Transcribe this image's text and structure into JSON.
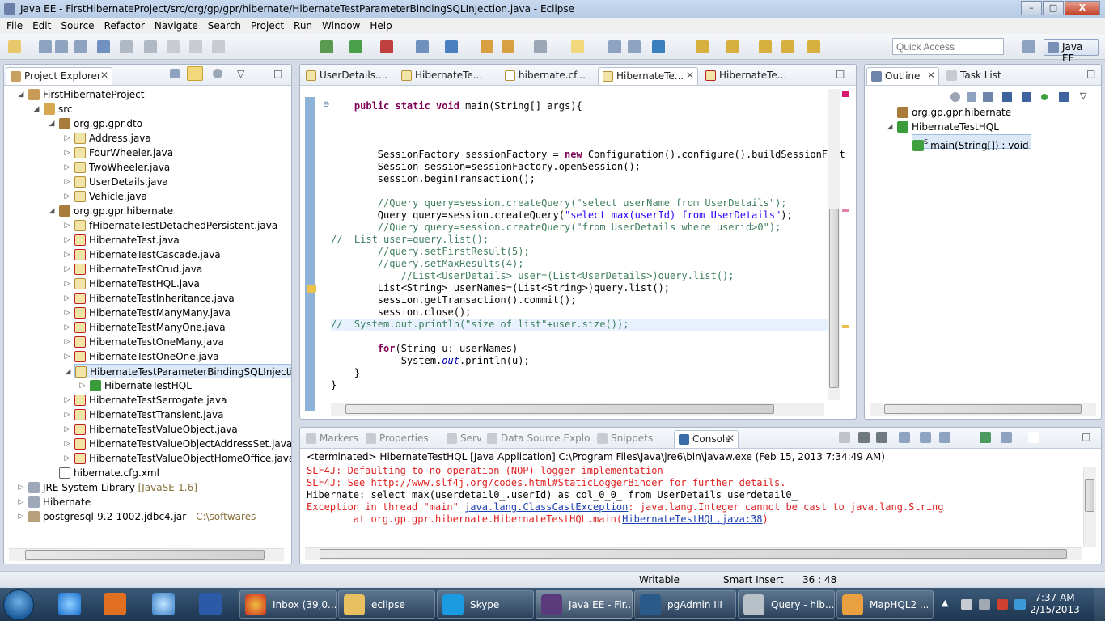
{
  "window": {
    "title": "Java EE - FirstHibernateProject/src/org/gp/gpr/hibernate/HibernateTestParameterBindingSQLInjection.java - Eclipse",
    "controls": {
      "minimize": "–",
      "maximize": "□",
      "close": "X"
    }
  },
  "menu": [
    "File",
    "Edit",
    "Source",
    "Refactor",
    "Navigate",
    "Search",
    "Project",
    "Run",
    "Window",
    "Help"
  ],
  "toolbar": {
    "quick_access_placeholder": "Quick Access",
    "perspective": "Java EE"
  },
  "project_explorer": {
    "title": "Project Explorer",
    "tree": [
      {
        "label": "FirstHibernateProject",
        "icon": "project-icon",
        "depth": 0,
        "twisty": "open"
      },
      {
        "label": "src",
        "icon": "source-folder-icon",
        "depth": 1,
        "twisty": "open"
      },
      {
        "label": "org.gp.gpr.dto",
        "icon": "package-icon",
        "depth": 2,
        "twisty": "open"
      },
      {
        "label": "Address.java",
        "icon": "java-file-icon",
        "depth": 3,
        "twisty": "closed"
      },
      {
        "label": "FourWheeler.java",
        "icon": "java-file-icon",
        "depth": 3,
        "twisty": "closed"
      },
      {
        "label": "TwoWheeler.java",
        "icon": "java-file-icon",
        "depth": 3,
        "twisty": "closed"
      },
      {
        "label": "UserDetails.java",
        "icon": "java-file-icon",
        "depth": 3,
        "twisty": "closed"
      },
      {
        "label": "Vehicle.java",
        "icon": "java-file-icon",
        "depth": 3,
        "twisty": "closed"
      },
      {
        "label": "org.gp.gpr.hibernate",
        "icon": "package-error-icon",
        "depth": 2,
        "twisty": "open"
      },
      {
        "label": "fHibernateTestDetachedPersistent.java",
        "icon": "java-file-icon",
        "depth": 3,
        "twisty": "closed"
      },
      {
        "label": "HibernateTest.java",
        "icon": "java-error-icon",
        "depth": 3,
        "twisty": "closed"
      },
      {
        "label": "HibernateTestCascade.java",
        "icon": "java-error-icon",
        "depth": 3,
        "twisty": "closed"
      },
      {
        "label": "HibernateTestCrud.java",
        "icon": "java-error-icon",
        "depth": 3,
        "twisty": "closed"
      },
      {
        "label": "HibernateTestHQL.java",
        "icon": "java-file-icon",
        "depth": 3,
        "twisty": "closed"
      },
      {
        "label": "HibernateTestInheritance.java",
        "icon": "java-error-icon",
        "depth": 3,
        "twisty": "closed"
      },
      {
        "label": "HibernateTestManyMany.java",
        "icon": "java-error-icon",
        "depth": 3,
        "twisty": "closed"
      },
      {
        "label": "HibernateTestManyOne.java",
        "icon": "java-error-icon",
        "depth": 3,
        "twisty": "closed"
      },
      {
        "label": "HibernateTestOneMany.java",
        "icon": "java-error-icon",
        "depth": 3,
        "twisty": "closed"
      },
      {
        "label": "HibernateTestOneOne.java",
        "icon": "java-error-icon",
        "depth": 3,
        "twisty": "closed"
      },
      {
        "label": "HibernateTestParameterBindingSQLInjection.j",
        "icon": "java-file-icon",
        "depth": 3,
        "twisty": "open",
        "selected": true
      },
      {
        "label": "HibernateTestHQL",
        "icon": "class-icon",
        "depth": 4,
        "twisty": "closed"
      },
      {
        "label": "HibernateTestSerrogate.java",
        "icon": "java-error-icon",
        "depth": 3,
        "twisty": "closed"
      },
      {
        "label": "HibernateTestTransient.java",
        "icon": "java-error-icon",
        "depth": 3,
        "twisty": "closed"
      },
      {
        "label": "HibernateTestValueObject.java",
        "icon": "java-error-icon",
        "depth": 3,
        "twisty": "closed"
      },
      {
        "label": "HibernateTestValueObjectAddressSet.java",
        "icon": "java-error-icon",
        "depth": 3,
        "twisty": "closed"
      },
      {
        "label": "HibernateTestValueObjectHomeOffice.java",
        "icon": "java-error-icon",
        "depth": 3,
        "twisty": "closed"
      },
      {
        "label": "hibernate.cfg.xml",
        "icon": "xml-file-icon",
        "depth": 2,
        "twisty": "none"
      },
      {
        "label": "JRE System Library",
        "decoration": " [JavaSE-1.6]",
        "icon": "library-icon",
        "depth": 0,
        "twisty": "closed"
      },
      {
        "label": "Hibernate",
        "icon": "library-icon",
        "depth": 0,
        "twisty": "closed"
      },
      {
        "label": "postgresql-9.2-1002.jdbc4.jar",
        "decoration": " - C:\\softwares",
        "icon": "jar-icon",
        "depth": 0,
        "twisty": "closed"
      }
    ]
  },
  "editor": {
    "tabs": [
      {
        "label": "UserDetails....",
        "icon": "java-file-icon",
        "active": false
      },
      {
        "label": "HibernateTe...",
        "icon": "java-file-icon",
        "active": false
      },
      {
        "label": "hibernate.cf...",
        "icon": "xml-file-icon",
        "active": false
      },
      {
        "label": "HibernateTe...",
        "icon": "java-file-icon",
        "active": true
      },
      {
        "label": "HibernateTe...",
        "icon": "java-error-icon",
        "active": false
      }
    ],
    "lines": [
      {
        "row": 0,
        "indent": 1,
        "tokens": [
          {
            "t": "public static void",
            "c": "kw"
          },
          {
            "t": " main(String[] args){",
            "c": ""
          }
        ]
      },
      {
        "row": 4,
        "indent": 2,
        "tokens": [
          {
            "t": "SessionFactory sessionFactory = ",
            "c": ""
          },
          {
            "t": "new",
            "c": "kw"
          },
          {
            "t": " Configuration().configure().buildSessionFact",
            "c": ""
          }
        ]
      },
      {
        "row": 5,
        "indent": 2,
        "tokens": [
          {
            "t": "Session session=sessionFactory.openSession();",
            "c": ""
          }
        ]
      },
      {
        "row": 6,
        "indent": 2,
        "tokens": [
          {
            "t": "session.beginTransaction();",
            "c": ""
          }
        ]
      },
      {
        "row": 8,
        "indent": 2,
        "tokens": [
          {
            "t": "//Query query=session.createQuery(\"select userName from UserDetails\");",
            "c": "cm"
          }
        ]
      },
      {
        "row": 9,
        "indent": 2,
        "tokens": [
          {
            "t": "Query query=session.createQuery(",
            "c": ""
          },
          {
            "t": "\"select max(userId) from UserDetails\"",
            "c": "st"
          },
          {
            "t": ");",
            "c": ""
          }
        ]
      },
      {
        "row": 10,
        "indent": 2,
        "tokens": [
          {
            "t": "//Query query=session.createQuery(\"from UserDetails where userid>0\");",
            "c": "cm"
          }
        ]
      },
      {
        "row": 11,
        "indent": 0,
        "tokens": [
          {
            "t": "//  List user=query.list();",
            "c": "cm"
          }
        ]
      },
      {
        "row": 12,
        "indent": 2,
        "tokens": [
          {
            "t": "//query.setFirstResult(5);",
            "c": "cm"
          }
        ]
      },
      {
        "row": 13,
        "indent": 2,
        "tokens": [
          {
            "t": "//query.setMaxResults(4);",
            "c": "cm"
          }
        ]
      },
      {
        "row": 14,
        "indent": 3,
        "tokens": [
          {
            "t": "//List<UserDetails> user=(List<UserDetails>)query.list();",
            "c": "cm"
          }
        ]
      },
      {
        "row": 15,
        "indent": 2,
        "tokens": [
          {
            "t": "List<String> userNames=(List<String>)query.list();",
            "c": ""
          }
        ]
      },
      {
        "row": 16,
        "indent": 2,
        "tokens": [
          {
            "t": "session.getTransaction().commit();",
            "c": ""
          }
        ]
      },
      {
        "row": 17,
        "indent": 2,
        "tokens": [
          {
            "t": "session.close();",
            "c": ""
          }
        ]
      },
      {
        "row": 18,
        "indent": 0,
        "hl": true,
        "tokens": [
          {
            "t": "//  System.out.println(\"size of list\"+user.size());",
            "c": "cm"
          }
        ]
      },
      {
        "row": 20,
        "indent": 2,
        "tokens": [
          {
            "t": "for",
            "c": "kw"
          },
          {
            "t": "(String u: userNames)",
            "c": ""
          }
        ]
      },
      {
        "row": 21,
        "indent": 3,
        "tokens": [
          {
            "t": "System.",
            "c": ""
          },
          {
            "t": "out",
            "c": "it"
          },
          {
            "t": ".println(u);",
            "c": ""
          }
        ]
      },
      {
        "row": 22,
        "indent": 1,
        "tokens": [
          {
            "t": "}",
            "c": ""
          }
        ]
      },
      {
        "row": 23,
        "indent": 0,
        "tokens": [
          {
            "t": "}",
            "c": ""
          }
        ]
      }
    ]
  },
  "outline": {
    "tabs": [
      {
        "label": "Outline",
        "active": true
      },
      {
        "label": "Task List",
        "active": false
      }
    ],
    "tree": [
      {
        "label": "org.gp.gpr.hibernate",
        "icon": "package-icon",
        "depth": 0,
        "twisty": "none"
      },
      {
        "label": "HibernateTestHQL",
        "icon": "class-icon",
        "depth": 0,
        "twisty": "open"
      },
      {
        "label": "main(String[]) : void",
        "icon": "method-icon",
        "depth": 1,
        "twisty": "none",
        "selected": true,
        "badge": "S"
      }
    ]
  },
  "console": {
    "tabs": [
      {
        "label": "Markers",
        "active": false
      },
      {
        "label": "Properties",
        "active": false
      },
      {
        "label": "Servers",
        "active": false
      },
      {
        "label": "Data Source Explorer",
        "active": false
      },
      {
        "label": "Snippets",
        "active": false
      },
      {
        "label": "Console",
        "active": true
      }
    ],
    "header": "<terminated> HibernateTestHQL [Java Application] C:\\Program Files\\Java\\jre6\\bin\\javaw.exe (Feb 15, 2013 7:34:49 AM)",
    "lines": [
      {
        "parts": [
          {
            "t": "SLF4J: Defaulting to no-operation (NOP) logger implementation",
            "c": "con-err"
          }
        ]
      },
      {
        "parts": [
          {
            "t": "SLF4J: See http://www.slf4j.org/codes.html#StaticLoggerBinder for further details.",
            "c": "con-err"
          }
        ]
      },
      {
        "parts": [
          {
            "t": "Hibernate: select max(userdetail0_.userId) as col_0_0_ from UserDetails userdetail0_",
            "c": ""
          }
        ]
      },
      {
        "parts": [
          {
            "t": "Exception in thread \"main\" ",
            "c": "con-err"
          },
          {
            "t": "java.lang.ClassCastException",
            "c": "con-link"
          },
          {
            "t": ": java.lang.Integer cannot be cast to java.lang.String",
            "c": "con-err"
          }
        ]
      },
      {
        "parts": [
          {
            "t": "\tat org.gp.gpr.hibernate.HibernateTestHQL.main(",
            "c": "con-err"
          },
          {
            "t": "HibernateTestHQL.java:38",
            "c": "con-link"
          },
          {
            "t": ")",
            "c": "con-err"
          }
        ]
      }
    ]
  },
  "status": {
    "writable": "Writable",
    "insert_mode": "Smart Insert",
    "position": "36 : 48"
  },
  "taskbar": {
    "tasks": [
      {
        "label": "Inbox (39,0...",
        "icon": "chrome-icon"
      },
      {
        "label": "eclipse",
        "icon": "folder-icon"
      },
      {
        "label": "Skype",
        "icon": "skype-icon"
      },
      {
        "label": "Java EE - Fir...",
        "icon": "eclipse-icon",
        "active": true
      },
      {
        "label": "pgAdmin III",
        "icon": "pgadmin-icon"
      },
      {
        "label": "Query - hib...",
        "icon": "sql-icon"
      },
      {
        "label": "MapHQL2 ...",
        "icon": "paint-icon"
      }
    ],
    "clock_time": "7:37 AM",
    "clock_date": "2/15/2013"
  }
}
